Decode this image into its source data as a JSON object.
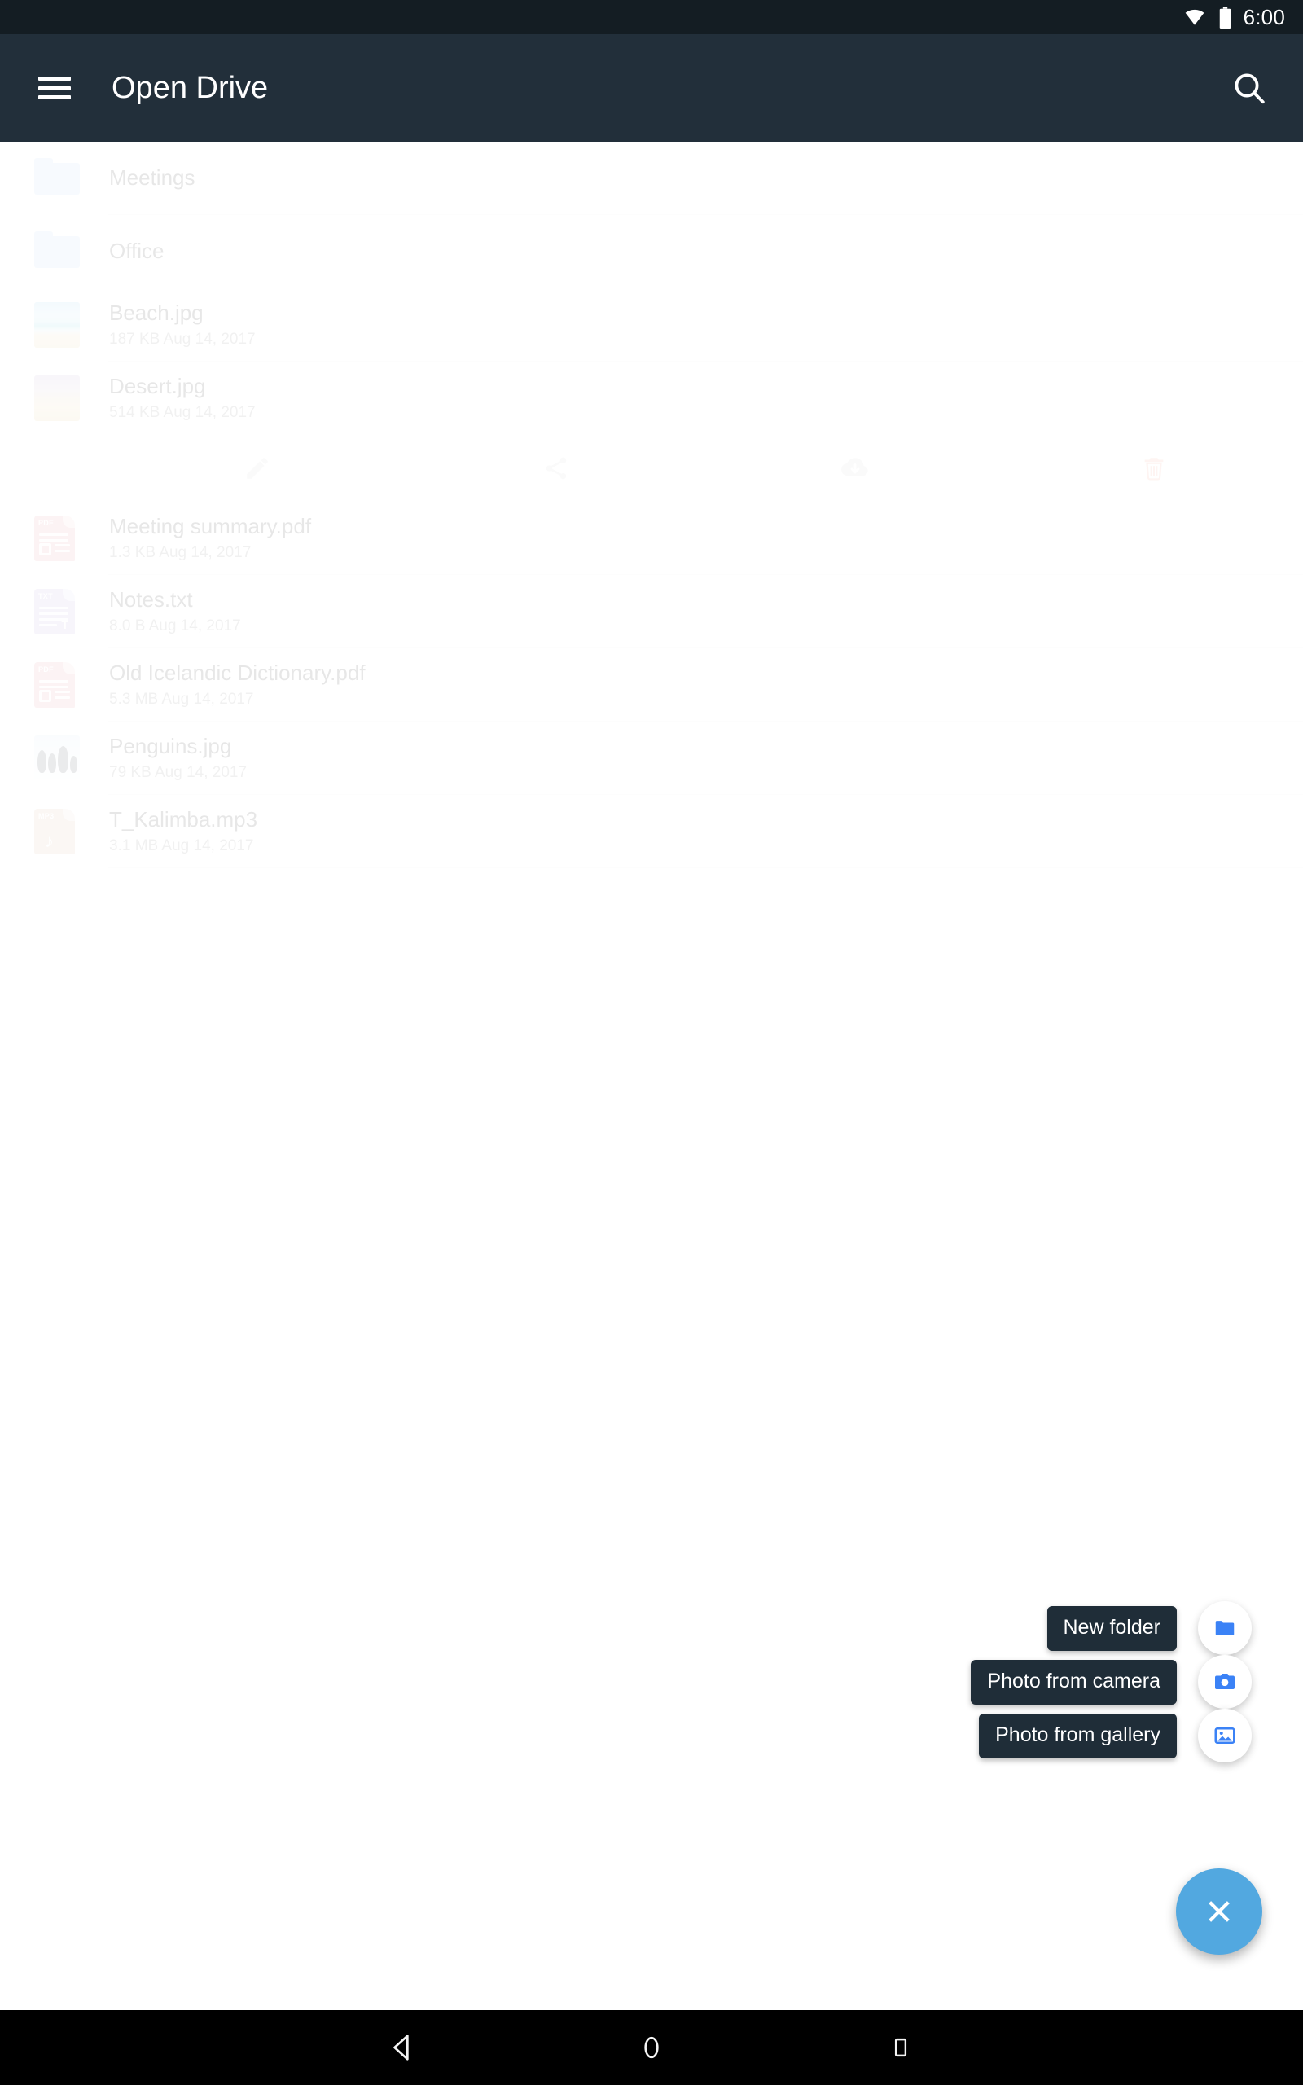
{
  "status_bar": {
    "time": "6:00",
    "icons": [
      "wifi-icon",
      "battery-icon"
    ]
  },
  "app_bar": {
    "title": "Open Drive",
    "menu_icon": "hamburger-menu-icon",
    "search_icon": "search-icon",
    "background": "#222f3a"
  },
  "file_list": [
    {
      "name": "Meetings",
      "meta": "",
      "kind": "folder",
      "icon": "folder-icon"
    },
    {
      "name": "Office",
      "meta": "",
      "kind": "folder",
      "icon": "folder-icon"
    },
    {
      "name": "Beach.jpg",
      "meta": "187 KB Aug 14, 2017",
      "kind": "image",
      "icon": "beach-thumbnail"
    },
    {
      "name": "Desert.jpg",
      "meta": "514 KB Aug 14, 2017",
      "kind": "image",
      "icon": "desert-thumbnail"
    },
    {
      "name": "Meeting summary.pdf",
      "meta": "1.3 KB Aug 14, 2017",
      "kind": "pdf",
      "icon": "pdf-file-icon",
      "tag": "PDF"
    },
    {
      "name": "Notes.txt",
      "meta": "8.0 B Aug 14, 2017",
      "kind": "txt",
      "icon": "txt-file-icon",
      "tag": "TXT"
    },
    {
      "name": "Old Icelandic Dictionary.pdf",
      "meta": "5.3 MB Aug 14, 2017",
      "kind": "pdf",
      "icon": "pdf-file-icon",
      "tag": "PDF"
    },
    {
      "name": "Penguins.jpg",
      "meta": "79 KB Aug 14, 2017",
      "kind": "image",
      "icon": "penguins-thumbnail"
    },
    {
      "name": "T_Kalimba.mp3",
      "meta": "3.1 MB Aug 14, 2017",
      "kind": "mp3",
      "icon": "mp3-file-icon",
      "tag": "MP3"
    }
  ],
  "action_bar": {
    "after_row_index": 3,
    "actions": [
      {
        "name": "rename-action",
        "icon": "pencil-icon",
        "color": "#d3d3d3"
      },
      {
        "name": "share-action",
        "icon": "share-icon",
        "color": "#d3d3d3"
      },
      {
        "name": "download-action",
        "icon": "cloud-download-icon",
        "color": "#d3d3d3"
      },
      {
        "name": "delete-action",
        "icon": "trash-icon",
        "color": "#f0b0a0"
      }
    ]
  },
  "fab_menu": {
    "expanded": true,
    "main_fab": {
      "icon": "close-icon",
      "color": "#52a8e0"
    },
    "items": [
      {
        "label": "New folder",
        "icon": "folder-icon",
        "icon_color": "#3b82f6"
      },
      {
        "label": "Photo from camera",
        "icon": "camera-icon",
        "icon_color": "#3b82f6"
      },
      {
        "label": "Photo from gallery",
        "icon": "image-icon",
        "icon_color": "#3b82f6"
      }
    ]
  },
  "nav_bar": {
    "buttons": [
      {
        "name": "back-button",
        "icon": "triangle-back-icon"
      },
      {
        "name": "home-button",
        "icon": "circle-home-icon"
      },
      {
        "name": "recents-button",
        "icon": "square-recents-icon"
      }
    ]
  }
}
